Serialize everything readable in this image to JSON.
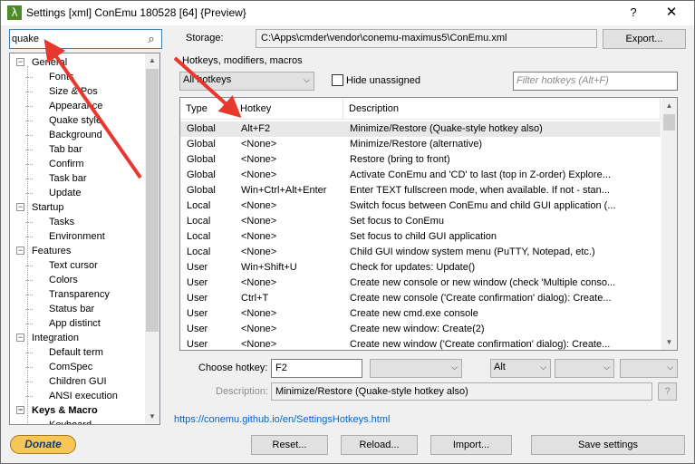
{
  "window": {
    "title": "Settings [xml] ConEmu 180528 [64] {Preview}",
    "help_glyph": "?",
    "close_glyph": "✕",
    "app_icon_glyph": "λ"
  },
  "search": {
    "value": "quake",
    "icon": "search-icon"
  },
  "storage": {
    "label": "Storage:",
    "path": "C:\\Apps\\cmder\\vendor\\conemu-maximus5\\ConEmu.xml",
    "export_label": "Export..."
  },
  "tree": {
    "items": [
      {
        "label": "General",
        "level": 0,
        "expanded": true
      },
      {
        "label": "Fonts",
        "level": 1
      },
      {
        "label": "Size & Pos",
        "level": 1
      },
      {
        "label": "Appearance",
        "level": 1
      },
      {
        "label": "Quake style",
        "level": 1
      },
      {
        "label": "Background",
        "level": 1
      },
      {
        "label": "Tab bar",
        "level": 1
      },
      {
        "label": "Confirm",
        "level": 1
      },
      {
        "label": "Task bar",
        "level": 1
      },
      {
        "label": "Update",
        "level": 1
      },
      {
        "label": "Startup",
        "level": 0,
        "expanded": true
      },
      {
        "label": "Tasks",
        "level": 1
      },
      {
        "label": "Environment",
        "level": 1
      },
      {
        "label": "Features",
        "level": 0,
        "expanded": true
      },
      {
        "label": "Text cursor",
        "level": 1
      },
      {
        "label": "Colors",
        "level": 1
      },
      {
        "label": "Transparency",
        "level": 1
      },
      {
        "label": "Status bar",
        "level": 1
      },
      {
        "label": "App distinct",
        "level": 1
      },
      {
        "label": "Integration",
        "level": 0,
        "expanded": true
      },
      {
        "label": "Default term",
        "level": 1
      },
      {
        "label": "ComSpec",
        "level": 1
      },
      {
        "label": "Children GUI",
        "level": 1
      },
      {
        "label": "ANSI execution",
        "level": 1
      },
      {
        "label": "Keys & Macro",
        "level": 0,
        "expanded": true,
        "selected": true
      },
      {
        "label": "Keyboard",
        "level": 1
      }
    ]
  },
  "hotkeys": {
    "group_label": "Hotkeys, modifiers, macros",
    "filter_combo": "All hotkeys",
    "hide_unassigned_label": "Hide unassigned",
    "hide_unassigned_checked": false,
    "filter_placeholder": "Filter hotkeys (Alt+F)",
    "columns": [
      "Type",
      "Hotkey",
      "Description"
    ],
    "rows": [
      {
        "type": "Global",
        "hotkey": "Alt+F2",
        "desc": "Minimize/Restore (Quake-style hotkey also)",
        "selected": true
      },
      {
        "type": "Global",
        "hotkey": "<None>",
        "desc": "Minimize/Restore (alternative)"
      },
      {
        "type": "Global",
        "hotkey": "<None>",
        "desc": "Restore (bring to front)"
      },
      {
        "type": "Global",
        "hotkey": "<None>",
        "desc": "Activate ConEmu and 'CD' to last (top in Z-order) Explore..."
      },
      {
        "type": "Global",
        "hotkey": "Win+Ctrl+Alt+Enter",
        "desc": "Enter TEXT fullscreen mode, when available. If not - stan..."
      },
      {
        "type": "Local",
        "hotkey": "<None>",
        "desc": "Switch focus between ConEmu and child GUI application (..."
      },
      {
        "type": "Local",
        "hotkey": "<None>",
        "desc": "Set focus to ConEmu"
      },
      {
        "type": "Local",
        "hotkey": "<None>",
        "desc": "Set focus to child GUI application"
      },
      {
        "type": "Local",
        "hotkey": "<None>",
        "desc": "Child GUI window system menu (PuTTY, Notepad, etc.)"
      },
      {
        "type": "User",
        "hotkey": "Win+Shift+U",
        "desc": "Check for updates: Update()"
      },
      {
        "type": "User",
        "hotkey": "<None>",
        "desc": "Create new console or new window (check 'Multiple conso..."
      },
      {
        "type": "User",
        "hotkey": "Ctrl+T",
        "desc": "Create new console ('Create confirmation' dialog): Create..."
      },
      {
        "type": "User",
        "hotkey": "<None>",
        "desc": "Create new cmd.exe console"
      },
      {
        "type": "User",
        "hotkey": "<None>",
        "desc": "Create new window: Create(2)"
      },
      {
        "type": "User",
        "hotkey": "<None>",
        "desc": "Create new window ('Create confirmation' dialog): Create..."
      }
    ]
  },
  "choose": {
    "label": "Choose hotkey:",
    "key_value": "F2",
    "combo1": "",
    "modifier": "Alt",
    "combo3": "",
    "combo4": "",
    "description_label": "Description:",
    "description_value": "Minimize/Restore (Quake-style hotkey also)",
    "more_label": "?"
  },
  "help_link": "https://conemu.github.io/en/SettingsHotkeys.html",
  "footer": {
    "donate": "Donate",
    "reset": "Reset...",
    "reload": "Reload...",
    "import": "Import...",
    "save": "Save settings"
  },
  "colors": {
    "annotation_arrow": "#e8372c",
    "link": "#0066cc",
    "accent": "#3c7fb1"
  }
}
